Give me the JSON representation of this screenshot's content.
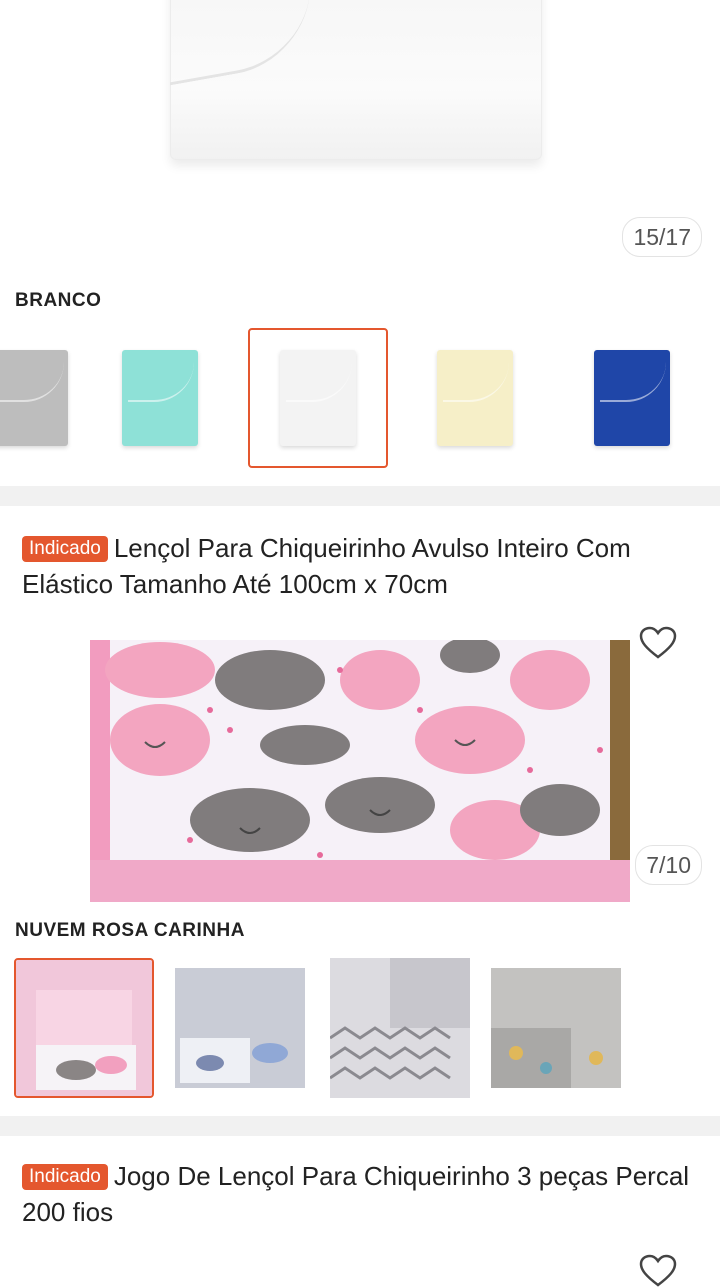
{
  "product1": {
    "image_counter": "15/17",
    "variant_label": "BRANCO",
    "swatches": [
      {
        "name": "cinza",
        "color": "#b9b9b9"
      },
      {
        "name": "verde-agua",
        "color": "#8ee1d7"
      },
      {
        "name": "branco",
        "color": "#f4f4f4",
        "selected": true
      },
      {
        "name": "creme",
        "color": "#f6efc8"
      },
      {
        "name": "azul",
        "color": "#1f46a8"
      }
    ]
  },
  "product2": {
    "badge": "Indicado",
    "title": "Lençol Para Chiqueirinho Avulso Inteiro Com Elástico Tamanho Até 100cm x 70cm",
    "image_counter": "7/10",
    "variant_label": "NUVEM ROSA CARINHA"
  },
  "product3": {
    "badge": "Indicado",
    "title": "Jogo De Lençol Para Chiqueirinho 3 peças Percal 200 fios"
  },
  "colors": {
    "accent": "#e4572e",
    "divider": "#f1f1f1"
  },
  "icons": {
    "favorite": "heart-outline-icon"
  }
}
